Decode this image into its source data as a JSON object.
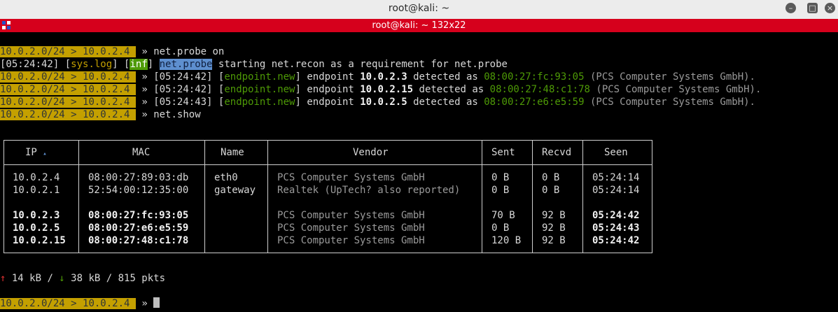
{
  "window": {
    "title": "root@kali: ~",
    "tab_title": "root@kali: ~ 132x22"
  },
  "prompt": {
    "subnet": "10.0.2.0/24",
    "sep": " > ",
    "ip": "10.0.2.4",
    "arrow": " » "
  },
  "log": {
    "cmd1": "net.probe on",
    "line2": {
      "time": "[05:24:42]",
      "tag": "sys.log",
      "level": "inf",
      "module": "net.probe",
      "msg": " starting net.recon as a requirement for net.probe"
    },
    "endpoints": [
      {
        "time": "[05:24:42]",
        "tag": "endpoint.new",
        "word": " endpoint ",
        "ip": "10.0.2.3",
        "mid": " detected as ",
        "mac": "08:00:27:fc:93:05",
        "vendor": " (PCS Computer Systems GmbH)."
      },
      {
        "time": "[05:24:42]",
        "tag": "endpoint.new",
        "word": " endpoint ",
        "ip": "10.0.2.15",
        "mid": " detected as ",
        "mac": "08:00:27:48:c1:78",
        "vendor": " (PCS Computer Systems GmbH)."
      },
      {
        "time": "[05:24:43]",
        "tag": "endpoint.new",
        "word": " endpoint ",
        "ip": "10.0.2.5",
        "mid": " detected as ",
        "mac": "08:00:27:e6:e5:59",
        "vendor": " (PCS Computer Systems GmbH)."
      }
    ],
    "cmd2": "net.show"
  },
  "table": {
    "headers": {
      "ip": "IP",
      "sort": "▴",
      "mac": "MAC",
      "name": "Name",
      "vendor": "Vendor",
      "sent": "Sent",
      "recvd": "Recvd",
      "seen": "Seen"
    },
    "rows": [
      {
        "ip": "10.0.2.4",
        "mac": "08:00:27:89:03:db",
        "name": "eth0",
        "vendor": "PCS Computer Systems GmbH",
        "sent": "0 B",
        "recvd": "0 B",
        "seen": "05:24:14"
      },
      {
        "ip": "10.0.2.1",
        "mac": "52:54:00:12:35:00",
        "name": "gateway",
        "vendor": "Realtek (UpTech? also reported)",
        "sent": "0 B",
        "recvd": "0 B",
        "seen": "05:24:14"
      },
      {
        "ip": "10.0.2.3",
        "mac": "08:00:27:fc:93:05",
        "name": "",
        "vendor": "PCS Computer Systems GmbH",
        "sent": "70 B",
        "recvd": "92 B",
        "seen": "05:24:42"
      },
      {
        "ip": "10.0.2.5",
        "mac": "08:00:27:e6:e5:59",
        "name": "",
        "vendor": "PCS Computer Systems GmbH",
        "sent": "0 B",
        "recvd": "92 B",
        "seen": "05:24:43"
      },
      {
        "ip": "10.0.2.15",
        "mac": "08:00:27:48:c1:78",
        "name": "",
        "vendor": "PCS Computer Systems GmbH",
        "sent": "120 B",
        "recvd": "92 B",
        "seen": "05:24:42"
      }
    ]
  },
  "stats": {
    "up_arrow": "↑",
    "up": " 14 kB / ",
    "down_arrow": "↓",
    "down": " 38 kB / 815 pkts"
  },
  "icons": {
    "minimize": "minimize-icon",
    "maximize": "maximize-icon",
    "close": "close-icon",
    "menu": "terminal-menu-icon"
  }
}
